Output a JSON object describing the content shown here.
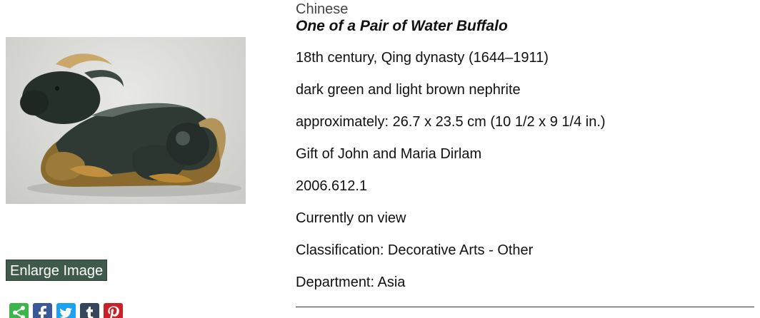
{
  "artwork": {
    "culture": "Chinese",
    "title": "One of a Pair of Water Buffalo",
    "date": "18th century, Qing dynasty (1644–1911)",
    "medium": "dark green and light brown nephrite",
    "dimensions": "approximately: 26.7 x 23.5 cm (10 1/2 x 9 1/4 in.)",
    "credit_line": "Gift of John and Maria Dirlam",
    "accession_number": "2006.612.1",
    "view_status": "Currently on view",
    "classification": "Classification: Decorative Arts - Other",
    "department": "Department: Asia"
  },
  "image_panel": {
    "enlarge_label": "Enlarge Image"
  },
  "share_buttons": [
    {
      "icon": "share-icon",
      "color": "#3bb54a"
    },
    {
      "icon": "facebook-icon",
      "color": "#3b5998"
    },
    {
      "icon": "twitter-icon",
      "color": "#1da1f2"
    },
    {
      "icon": "tumblr-icon",
      "color": "#35465c"
    },
    {
      "icon": "pinterest-icon",
      "color": "#cb2027"
    }
  ]
}
